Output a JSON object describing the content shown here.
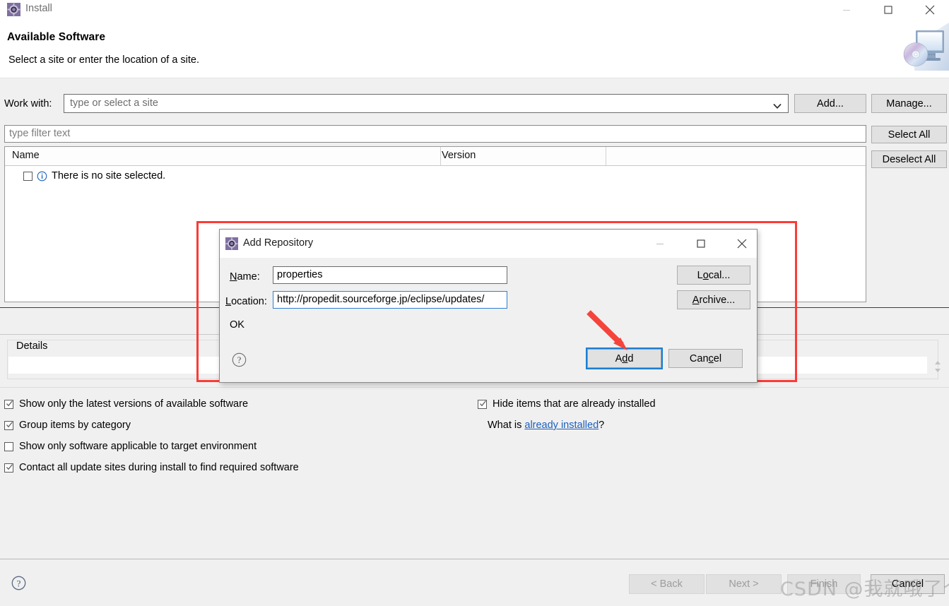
{
  "window": {
    "title": "Install",
    "icon": "install-gear-icon",
    "minimize": "minimize-icon",
    "maximize": "maximize-icon",
    "close": "close-icon"
  },
  "header": {
    "title": "Available Software",
    "subtitle": "Select a site or enter the location of a site.",
    "banner_icon": "monitor-cd-icon"
  },
  "work_with": {
    "label": "Work with:",
    "placeholder": "type or select a site",
    "value": "",
    "dropdown_icon": "chevron-down-icon",
    "add_button": "Add...",
    "manage_button": "Manage..."
  },
  "filter": {
    "placeholder": "type filter text",
    "value": "",
    "select_all": "Select All",
    "deselect_all": "Deselect All"
  },
  "tree": {
    "columns": [
      "Name",
      "Version"
    ],
    "rows": [
      {
        "checked": false,
        "icon": "info-icon",
        "label": "There is no site selected."
      }
    ]
  },
  "details": {
    "label": "Details",
    "value": "",
    "spinner_icon": "collapse-expand-arrows-icon"
  },
  "options": {
    "left": [
      {
        "label": "Show only the latest versions of available software",
        "checked": true
      },
      {
        "label": "Group items by category",
        "checked": true
      },
      {
        "label": "Show only software applicable to target environment",
        "checked": false
      },
      {
        "label": "Contact all update sites during install to find required software",
        "checked": true
      }
    ],
    "right": [
      {
        "label": "Hide items that are already installed",
        "checked": true
      }
    ],
    "what_is_prefix": "What is ",
    "what_is_link": "already installed",
    "what_is_suffix": "?"
  },
  "footer": {
    "help_icon": "help-question-icon",
    "back": "< Back",
    "next": "Next >",
    "finish": "Finish",
    "cancel": "Cancel"
  },
  "watermark": "CSDN @我就哦了个哦",
  "dialog": {
    "title": "Add Repository",
    "icon": "install-gear-icon",
    "minimize": "minimize-icon",
    "maximize": "maximize-icon",
    "close": "close-icon",
    "name_label_pre": "N",
    "name_label_post": "ame:",
    "name_value": "properties",
    "location_label_pre": "L",
    "location_label_post": "ocation:",
    "location_value": "http://propedit.sourceforge.jp/eclipse/updates/",
    "local_pre": "L",
    "local_mid": "o",
    "local_post": "cal...",
    "archive_pre": "A",
    "archive_post": "rchive...",
    "status": "OK",
    "help_icon": "help-question-icon",
    "add_pre": "A",
    "add_mid": "d",
    "add_post": "d",
    "cancel_pre": "Can",
    "cancel_mid": "c",
    "cancel_post": "el"
  },
  "annotations": {
    "highlight_rect": "red-highlight-rectangle",
    "arrow": "red-pointer-arrow",
    "accent_red": "#fc3b36",
    "accent_blue": "#1b7fd4"
  }
}
